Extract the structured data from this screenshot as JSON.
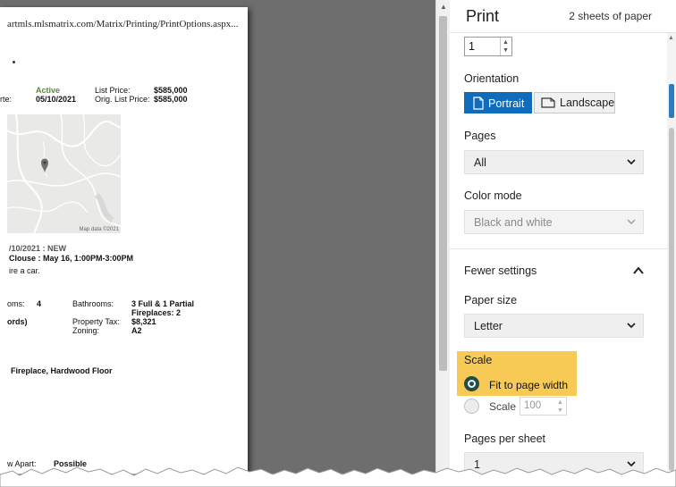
{
  "preview": {
    "url_text": "artmls.mlsmatrix.com/Matrix/Printing/PrintOptions.aspx...",
    "status": "Active",
    "date_label_fragment": "rte:",
    "date_value": "05/10/2021",
    "list_price_label": "List Price:",
    "list_price_value": "$585,000",
    "orig_price_label": "Orig. List Price:",
    "orig_price_value": "$585,000",
    "map_credit": "Map data ©2021",
    "history_line": "/10/2021 : NEW",
    "open_house_line": "Clouse : May 16, 1:00PM-3:00PM",
    "note_line": "ire a car.",
    "rooms_label": "oms:",
    "rooms_value": "4",
    "bathrooms_label": "Bathrooms:",
    "bathrooms_value": "3 Full & 1 Partial",
    "fireplaces_line": "Fireplaces: 2",
    "records_fragment": "ords)",
    "property_tax_label": "Property Tax:",
    "property_tax_value": "$8,321",
    "zoning_label": "Zoning:",
    "zoning_value": "A2",
    "features_line": "Fireplace, Hardwood Floor",
    "apart_label": "w Apart:",
    "apart_value": "Possible"
  },
  "panel": {
    "title": "Print",
    "sheet_count": "2 sheets of paper",
    "copies_value": "1",
    "orientation_label": "Orientation",
    "portrait_label": "Portrait",
    "landscape_label": "Landscape",
    "pages_label": "Pages",
    "pages_value": "All",
    "color_mode_label": "Color mode",
    "color_mode_value": "Black and white",
    "fewer_settings_label": "Fewer settings",
    "paper_size_label": "Paper size",
    "paper_size_value": "Letter",
    "scale_label": "Scale",
    "fit_option_label": "Fit to page width",
    "scale_option_label": "Scale",
    "scale_value_placeholder": "100",
    "pages_per_sheet_label": "Pages per sheet",
    "pages_per_sheet_value": "1"
  },
  "colors": {
    "accent": "#0f6cbd",
    "scale_highlight": "#f7ca55",
    "preview_background": "#6e6e6e",
    "radio_selected": "#1d4e4e"
  }
}
